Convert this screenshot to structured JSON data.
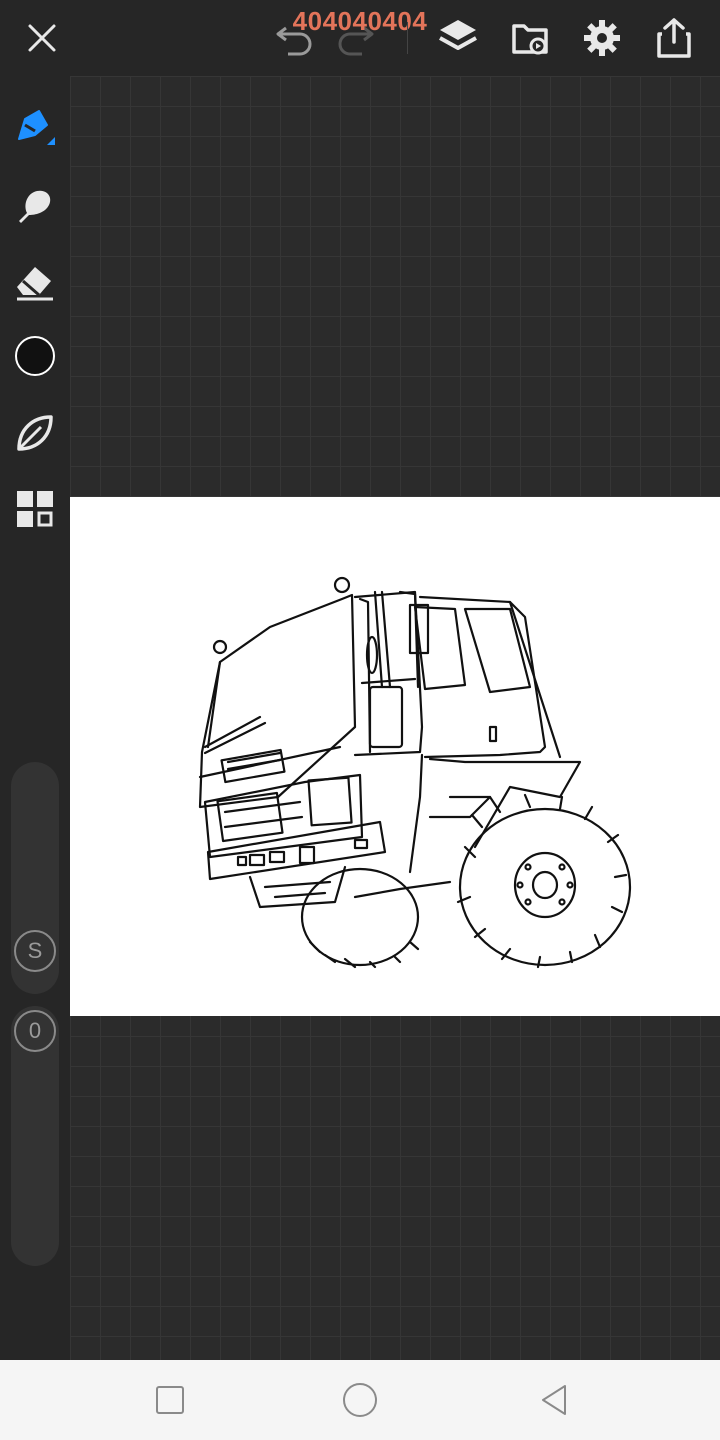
{
  "app": {
    "document_title": "404040404"
  },
  "toolbar": {
    "icons": [
      "close-icon",
      "undo-icon",
      "redo-icon",
      "layers-icon",
      "gallery-icon",
      "settings-icon",
      "share-icon"
    ]
  },
  "sidebar": {
    "tools": [
      "brush-icon",
      "smudge-icon",
      "eraser-icon",
      "color-swatch",
      "leaf-icon",
      "grid-icon"
    ],
    "current_color": "#111111",
    "accent_color": "#1e90ff",
    "size_slider_label": "S",
    "opacity_slider_label": "0"
  },
  "navigation": {
    "icons": [
      "recent-apps-icon",
      "home-icon",
      "back-icon"
    ]
  }
}
